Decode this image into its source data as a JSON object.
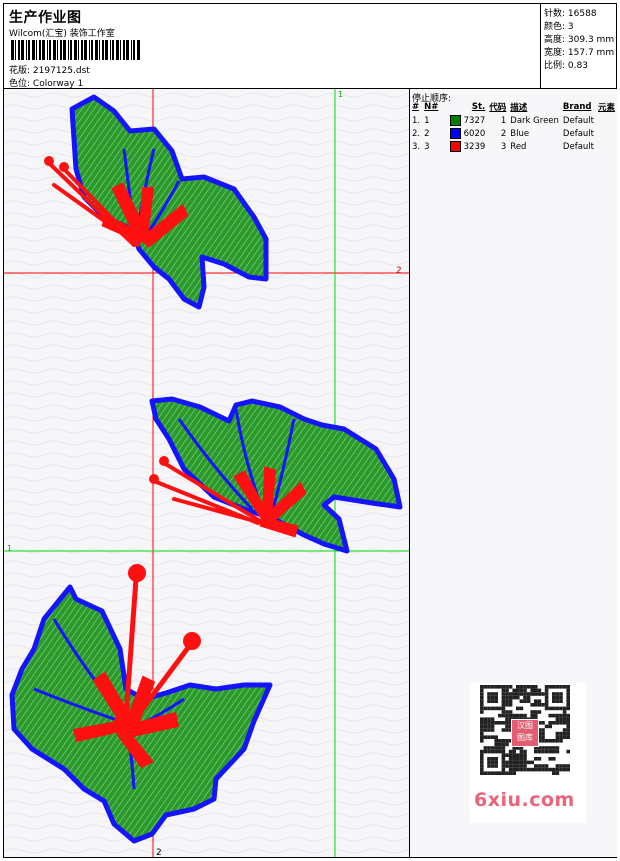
{
  "header": {
    "title": "生产作业图",
    "studio": "Wilcom(汇宝) 装饰工作室",
    "design_label": "花版:",
    "design_value": "2197125.dst",
    "colorway_label": "色位:",
    "colorway_value": "Colorway 1"
  },
  "stats": [
    {
      "label": "针数:",
      "value": "16588"
    },
    {
      "label": "颜色:",
      "value": "3"
    },
    {
      "label": "高度:",
      "value": "309.3 mm"
    },
    {
      "label": "宽度:",
      "value": "157.7 mm"
    },
    {
      "label": "比例:",
      "value": "0.83"
    }
  ],
  "legend": {
    "title": "停止顺序:",
    "headers": [
      "#",
      "N#",
      "St.",
      "代码",
      "描述",
      "Brand",
      "元素"
    ],
    "rows": [
      {
        "num": "1.",
        "n": "1",
        "stitches": "7327",
        "code": "1",
        "desc": "Dark Green",
        "brand": "Default",
        "color": "#008000"
      },
      {
        "num": "2.",
        "n": "2",
        "stitches": "6020",
        "code": "2",
        "desc": "Blue",
        "brand": "Default",
        "color": "#0000ff"
      },
      {
        "num": "3.",
        "n": "3",
        "stitches": "3239",
        "code": "3",
        "desc": "Red",
        "brand": "Default",
        "color": "#ff0000"
      }
    ]
  },
  "guides": {
    "label_1_top": "1",
    "label_2_right": "2",
    "label_1_left": "1",
    "label_2_bottom": "2"
  },
  "watermark": {
    "text": "6xiu.com",
    "seal": "汉图 图库"
  },
  "colors": {
    "green": "#1f8f1f",
    "blue": "#1414ff",
    "red": "#ff1010",
    "guide_red": "#ff0000",
    "guide_green": "#00dd00"
  }
}
